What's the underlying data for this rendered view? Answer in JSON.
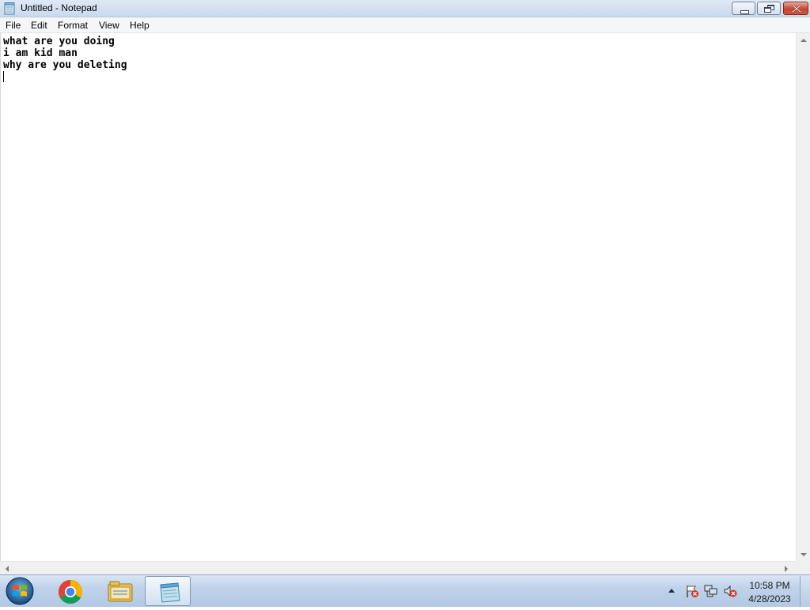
{
  "window": {
    "title": "Untitled - Notepad",
    "icon": "notepad-icon",
    "controls": [
      "minimize-icon",
      "restore-icon",
      "close-icon"
    ]
  },
  "menu": {
    "items": [
      "File",
      "Edit",
      "Format",
      "View",
      "Help"
    ]
  },
  "editor": {
    "lines": [
      "what are you doing",
      "i am kid man",
      "why are you deleting"
    ]
  },
  "taskbar": {
    "items": [
      {
        "name": "start-orb-icon"
      },
      {
        "name": "chrome-icon"
      },
      {
        "name": "file-explorer-icon"
      },
      {
        "name": "notepad-icon",
        "active": true
      }
    ],
    "tray_icons": [
      "show-hidden-icons-arrow",
      "action-center-flag-icon",
      "network-icon",
      "volume-muted-icon"
    ],
    "clock": {
      "time": "10:58 PM",
      "date": "4/28/2023"
    }
  },
  "colors": {
    "titlebar": "#c9d9ee",
    "close_button": "#c8452c",
    "taskbar": "#bfd2ea"
  }
}
